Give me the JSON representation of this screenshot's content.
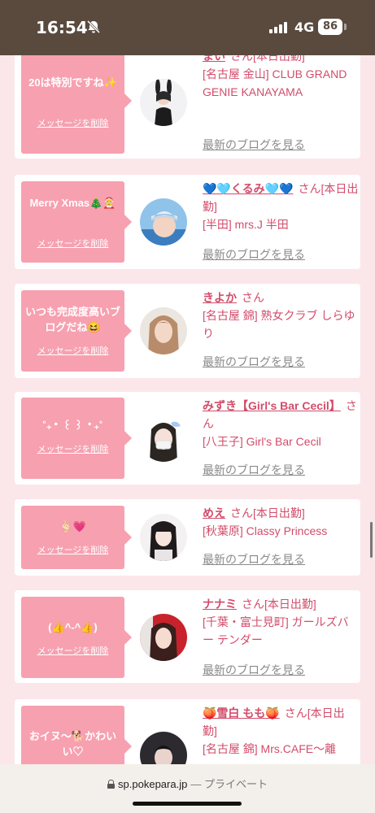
{
  "status_bar": {
    "time": "16:54",
    "network": "4G",
    "battery": "86"
  },
  "common": {
    "delete_label": "メッセージを削除",
    "san": "さん",
    "blog_label": "最新のブログを見る"
  },
  "cards": [
    {
      "message": "20は特別ですね✨",
      "name": "まい",
      "detail": "[本日出勤]\n[名古屋 金山] CLUB GRAND GENIE KANAYAMA"
    },
    {
      "message": "Merry Xmas🎄🤶",
      "name": "💙🩵くるみ🩵💙",
      "detail": "[本日出勤]\n[半田] mrs.J 半田"
    },
    {
      "message": "いつも完成度高いブログだね😆",
      "name": "きよか",
      "detail": "[名古屋 錦] 熟女クラブ しらゆり"
    },
    {
      "message": "˚₊‧ ꒰ ꒱ ‧₊˚",
      "name": "みずき【Girl's Bar Cecil】",
      "detail": "[八王子] Girl's Bar Cecil"
    },
    {
      "message": "🫰🏻💗",
      "name": "めえ",
      "detail": "[本日出勤]\n[秋葉原] Classy Princess"
    },
    {
      "message": "(👍^-^👍)",
      "name": "ナナミ",
      "detail": "[本日出勤]\n[千葉・富士見町] ガールズバー テンダー"
    },
    {
      "message": "おイヌ〜🐕かわいい♡",
      "name": "🍑雪白 もも🍑",
      "detail": "[本日出勤]\n[名古屋 錦] Mrs.CAFE〜離"
    }
  ],
  "browser": {
    "host": "sp.pokepara.jp",
    "suffix": "— プライベート"
  },
  "colors": {
    "accent": "#d24c6a",
    "bubble": "#f7a0b0",
    "page_bg": "#fbe6ea",
    "status_bar": "#5a4a3e"
  }
}
